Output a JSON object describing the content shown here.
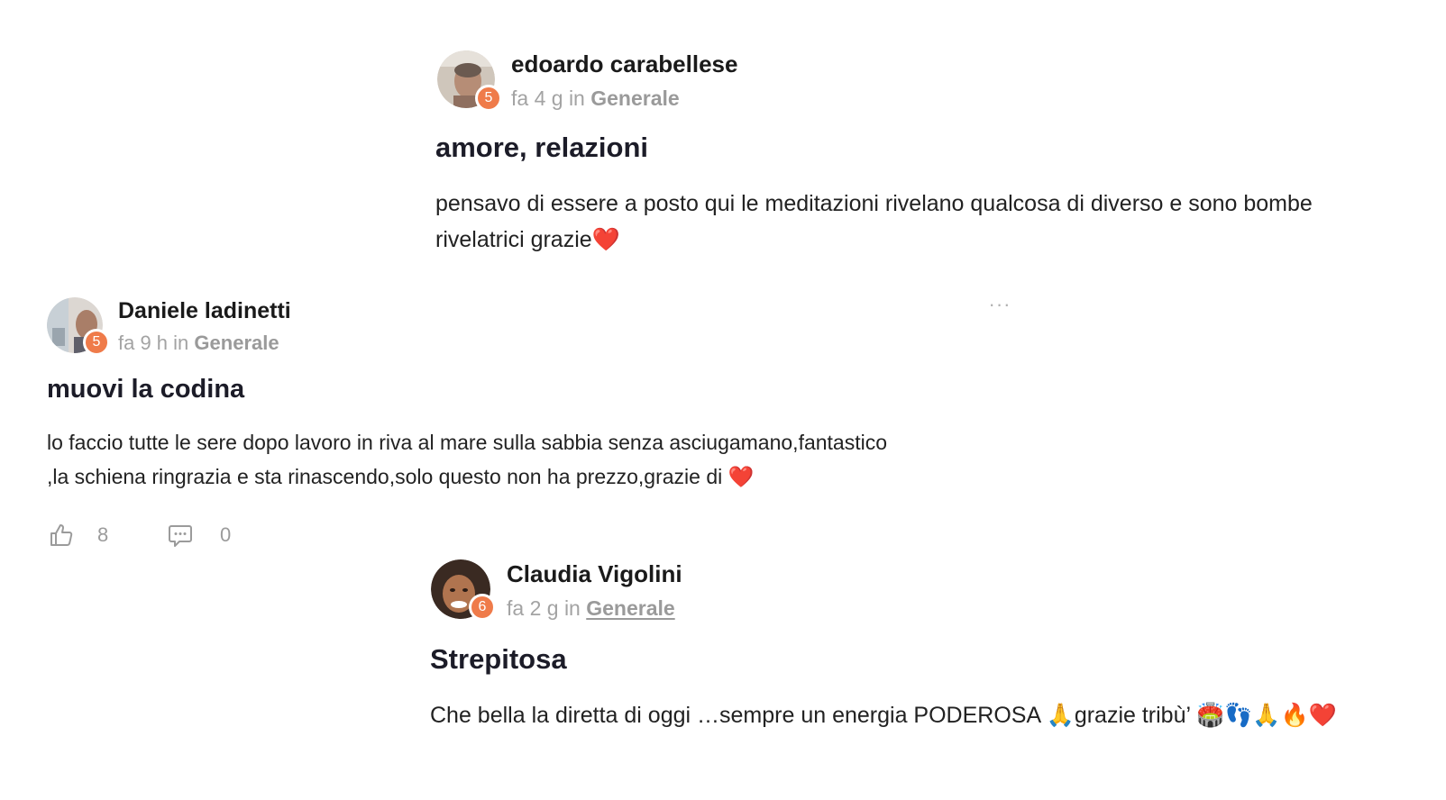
{
  "posts": [
    {
      "author": "edoardo carabellese",
      "level": "5",
      "time": "fa 4 g",
      "in_label": "in",
      "category": "Generale",
      "title": "amore, relazioni",
      "body_line1": "pensavo di essere a posto qui le meditazioni rivelano qualcosa di diverso e sono bombe",
      "body_line2": "rivelatrici grazie",
      "body_emoji": "❤️"
    },
    {
      "author": "Daniele ladinetti",
      "level": "5",
      "time": "fa 9 h",
      "in_label": "in",
      "category": "Generale",
      "title": "muovi la codina",
      "body_line1": "lo faccio tutte le sere dopo lavoro in riva al mare sulla sabbia senza asciugamano,fantastico",
      "body_line2": ",la schiena ringrazia e sta rinascendo,solo questo non ha prezzo,grazie di ",
      "body_emoji": "❤️",
      "more_label": "···",
      "likes": "8",
      "comments": "0"
    },
    {
      "author": "Claudia Vigolini",
      "level": "6",
      "time": "fa 2 g",
      "in_label": "in",
      "category": "Generale",
      "title": "Strepitosa",
      "body_text": "Che bella la diretta di oggi …sempre un energia PODEROSA 🙏grazie tribù’ 🏟️👣🙏🔥❤️"
    }
  ],
  "icons": {
    "like": "thumbs-up-icon",
    "comment": "comment-bubble-icon",
    "more": "ellipsis-icon"
  },
  "colors": {
    "badge": "#ef7b4a",
    "meta_text": "#a3a3a3",
    "title_text": "#1c1c28",
    "heart": "#e02424"
  }
}
